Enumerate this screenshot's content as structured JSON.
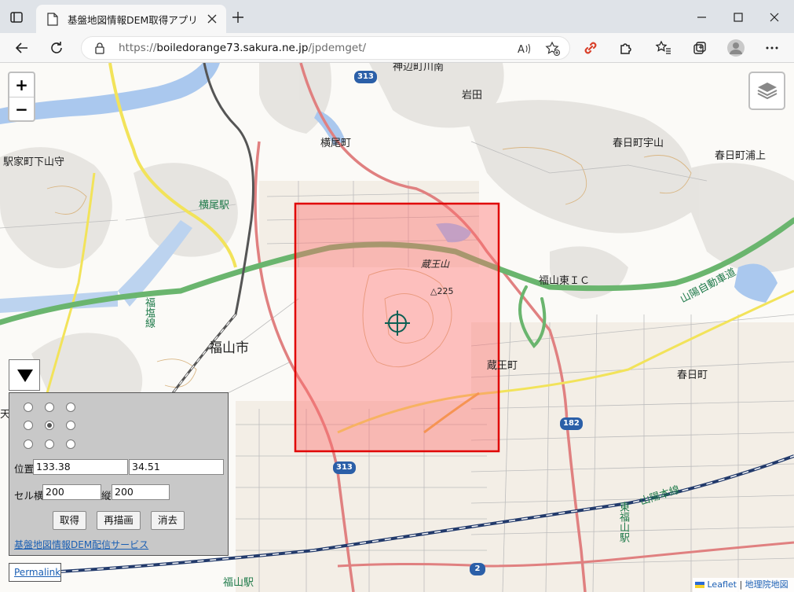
{
  "browser": {
    "tab_title": "基盤地図情報DEM取得アプリ",
    "url_protocol": "https://",
    "url_host": "boiledorange73.sakura.ne.jp",
    "url_path": "/jpdemget/",
    "accent_color": "#c0392b"
  },
  "map": {
    "zoom_in_label": "+",
    "zoom_out_label": "−",
    "labels": {
      "iwata": "岩田",
      "yokoo_cho": "横尾町",
      "kasuga_cho_uyama": "春日町宇山",
      "kasuga_cho_urakami": "春日町浦上",
      "ekiya_cho": "駅家町下山守",
      "yokoo_station": "横尾駅",
      "fukuyama_city": "福山市",
      "zaou_san": "蔵王山",
      "elevation": "225",
      "zaou_cho": "蔵王町",
      "fukuyama_higashi_ic": "福山東ＩＣ",
      "sanyo_expressway": "山陽自動車道",
      "kasuga_cho": "春日町",
      "fukuen_line": "福塩線",
      "sanyo_main_line": "山陽本線",
      "higashi_fukuyama_station": "東福山駅",
      "fukuyama_station": "福山駅",
      "kaminoji": "神辺町川南",
      "ten": "天"
    },
    "shields": {
      "route_313_top": "313",
      "route_313_bottom": "313",
      "route_182": "182",
      "route_2": "2"
    },
    "selection_color": "#e00000"
  },
  "panel": {
    "position_label": "位置",
    "longitude": "133.38",
    "latitude": "34.51",
    "cell_h_label": "セル横",
    "cell_h": "200",
    "cell_v_label": "縦",
    "cell_v": "200",
    "fetch_button": "取得",
    "redraw_button": "再描画",
    "clear_button": "消去",
    "service_link": "基盤地図情報DEM配信サービス",
    "selected_anchor": "center"
  },
  "permalink": "Permalink",
  "attribution": {
    "leaflet": "Leaflet",
    "separator": "|",
    "gsi": "地理院地図"
  }
}
